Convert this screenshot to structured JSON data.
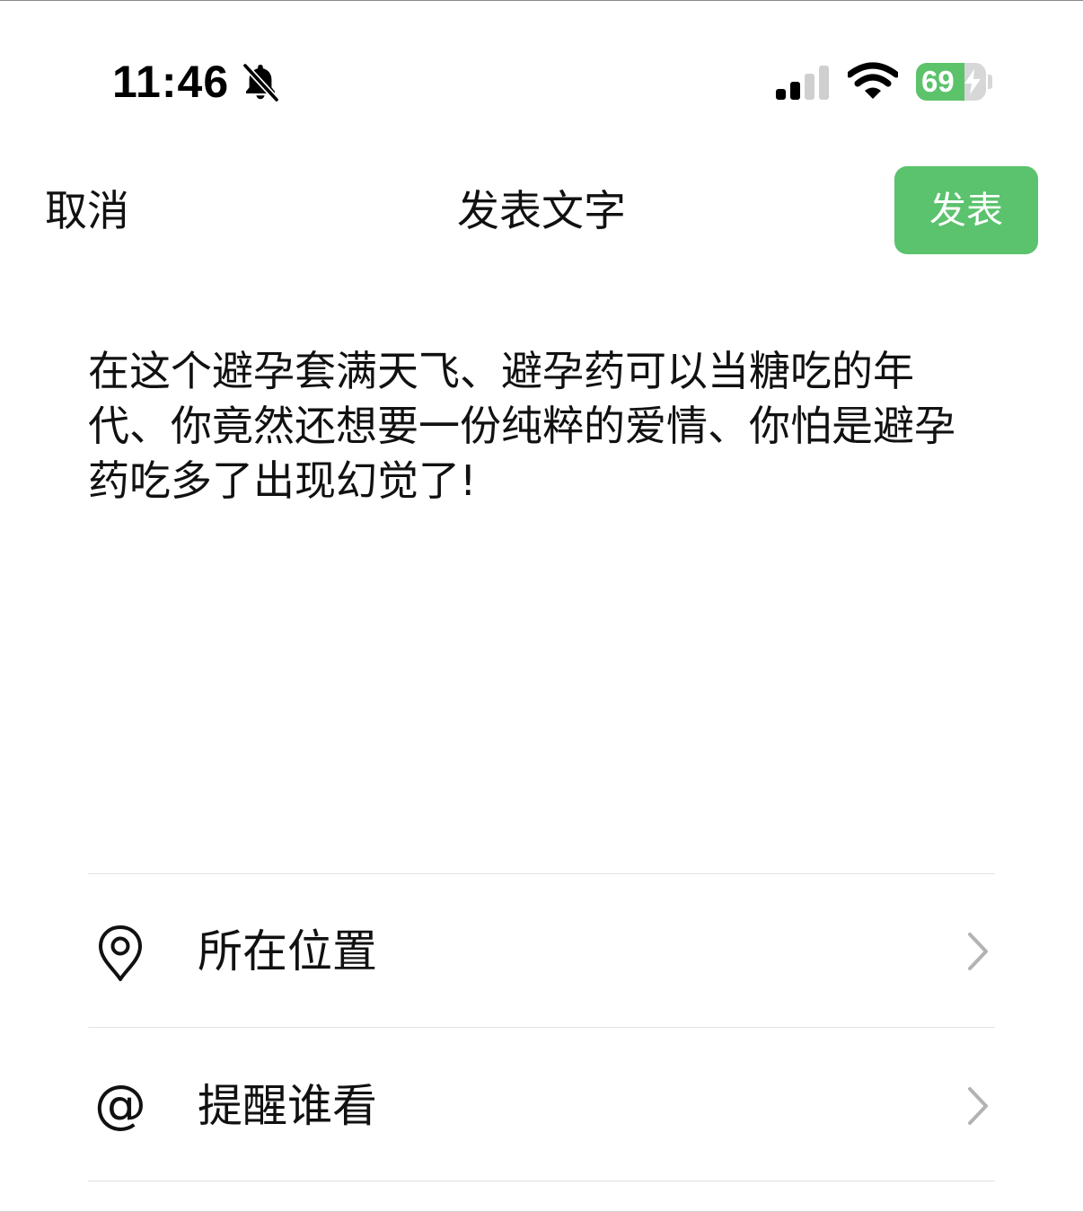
{
  "status_bar": {
    "time": "11:46",
    "mute_icon": "bell-slash-icon",
    "signal_icon": "cellular-signal-icon",
    "wifi_icon": "wifi-icon",
    "battery_percent": "69",
    "battery_level": 0.69,
    "battery_charging": true
  },
  "nav": {
    "cancel_label": "取消",
    "title": "发表文字",
    "publish_label": "发表"
  },
  "post": {
    "text": "在这个避孕套满天飞、避孕药可以当糖吃的年代、你竟然还想要一份纯粹的爱情、你怕是避孕药吃多了出现幻觉了!"
  },
  "options": [
    {
      "label": "所在位置",
      "icon": "location-pin-icon"
    },
    {
      "label": "提醒谁看",
      "icon": "at-sign-icon"
    }
  ],
  "colors": {
    "accent_green": "#5bc26d",
    "battery_green": "#5cc36b",
    "divider": "#e2e2e2",
    "chevron": "#b3b3b3"
  }
}
